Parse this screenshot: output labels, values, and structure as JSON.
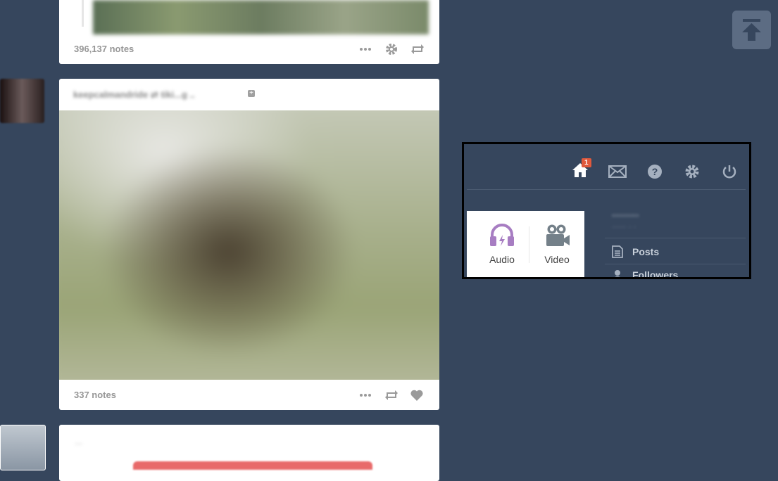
{
  "posts": [
    {
      "notes": "396,137 notes",
      "controls": [
        "more-icon",
        "gear-icon",
        "reblog-icon"
      ]
    },
    {
      "header": "keepcalmandride ⇄ tiki...g ..",
      "notes": "337 notes",
      "controls": [
        "more-icon",
        "reblog-icon",
        "heart-icon"
      ]
    },
    {
      "header": "..."
    }
  ],
  "topbar": {
    "home_badge": "1",
    "icons": [
      "home-icon",
      "mail-icon",
      "help-icon",
      "gear-icon",
      "power-icon"
    ]
  },
  "post_types": [
    {
      "label": "Audio",
      "icon": "headphones-icon",
      "color": "#a77dc2"
    },
    {
      "label": "Video",
      "icon": "video-camera-icon",
      "color": "#748089"
    }
  ],
  "account_menu": {
    "blog_name": "·········",
    "blog_title": "·····  · ·",
    "items": [
      {
        "label": "Posts",
        "icon": "posts-icon"
      },
      {
        "label": "Followers",
        "icon": "followers-icon"
      }
    ]
  },
  "scroll_top": {
    "icon": "scroll-to-top-icon"
  }
}
